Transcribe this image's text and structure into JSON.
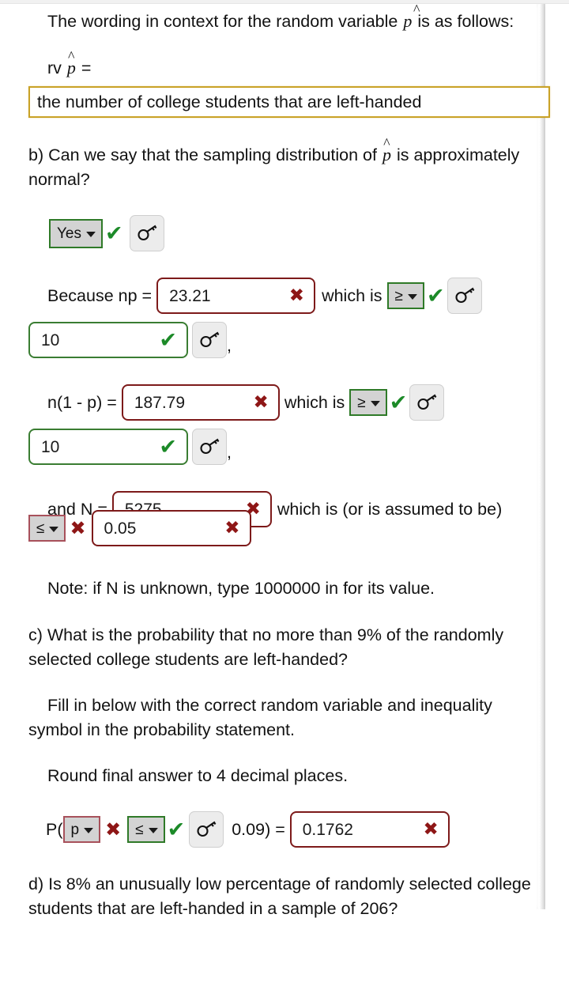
{
  "document": {
    "intro": {
      "text_before": "The wording in context for the random variable ",
      "symbol": "p",
      "hat": "^",
      "text_after": " is as follows:"
    },
    "rv_label_prefix": "rv ",
    "rv_label_suffix": " =",
    "rv_answer_value": "the number of college students that are left-handed"
  },
  "part_b": {
    "question_before": "b) Can we say that the sampling distribution of ",
    "question_after": " is approximately normal?",
    "answer_select": {
      "value": "Yes",
      "status": "correct",
      "options": [
        "Yes",
        "No"
      ]
    },
    "key_icon": "key-icon",
    "np_row": {
      "label": "Because np = ",
      "input_value": "23.21",
      "input_status": "incorrect",
      "which_is_label": "which is ",
      "compare_select": {
        "value": "≥",
        "status": "correct",
        "options": [
          "≥",
          "≤",
          ">",
          "<",
          "="
        ]
      },
      "threshold_value": "10",
      "threshold_status": "correct",
      "trailing_comma": ","
    },
    "nq_row": {
      "label": "n(1 - p) = ",
      "input_value": "187.79",
      "input_status": "incorrect",
      "which_is_label": "which is ",
      "compare_select": {
        "value": "≥",
        "status": "correct",
        "options": [
          "≥",
          "≤",
          ">",
          "<",
          "="
        ]
      },
      "threshold_value": "10",
      "threshold_status": "correct",
      "trailing_comma": ","
    },
    "N_row": {
      "label": "and N = ",
      "input_value": "5275",
      "input_status": "incorrect",
      "which_is_label": "which is (or is assumed to be) ",
      "compare_select": {
        "value": "≤",
        "status": "incorrect",
        "options": [
          "≥",
          "≤",
          ">",
          "<",
          "="
        ]
      },
      "fraction_value": "0.05",
      "fraction_status": "incorrect"
    },
    "note": "Note: if N is unknown, type 1000000 in for its value."
  },
  "part_c": {
    "question": "c) What is the probability that no more than 9% of the randomly selected college students are left-handed?",
    "instruction_1": "Fill in below with the correct random variable and inequality symbol in the probability statement.",
    "instruction_2": "Round final answer to 4 decimal places.",
    "prob_statement": {
      "open_paren": "P(",
      "rv_select": {
        "value": "p",
        "status": "incorrect",
        "options": [
          "p",
          "x",
          "p̂",
          "x̄"
        ]
      },
      "ineq_select": {
        "value": "≤",
        "status": "correct",
        "options": [
          "≥",
          "≤",
          ">",
          "<",
          "="
        ]
      },
      "constant": " 0.09) = ",
      "answer_value": "0.1762",
      "answer_status": "incorrect"
    }
  },
  "part_d": {
    "question": "d) Is 8% an unusually low percentage of randomly selected college students that are left-handed in a sample of 206?"
  },
  "colors": {
    "correct": "#1c8a28",
    "incorrect": "#8e1616",
    "focus_gold": "#c9a227",
    "select_bg": "#d3d3d3",
    "key_button_bg": "#ececec"
  },
  "icons": {
    "check": "✔",
    "cross": "✖",
    "caret_down": "⌄"
  }
}
